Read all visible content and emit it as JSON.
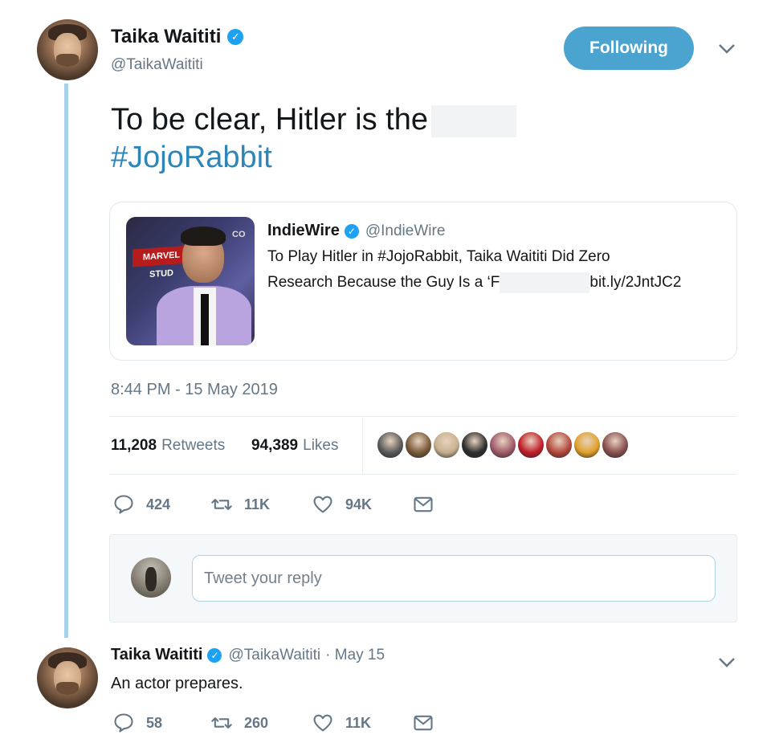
{
  "main_tweet": {
    "author_name": "Taika Waititi",
    "author_handle": "@TaikaWaititi",
    "follow_label": "Following",
    "text_line1": "To be clear, Hitler is the",
    "hashtag": "#JojoRabbit",
    "quote": {
      "author_name": "IndieWire",
      "author_handle": "@IndieWire",
      "text_line1": "To Play Hitler in #JojoRabbit, Taika Waititi Did Zero",
      "text_line2_start": "Research Because the Guy Is a ‘F",
      "text_line2_end": "bit.ly/2JntJC2",
      "image_texts": [
        "MARVEL STUD",
        "CO"
      ]
    },
    "timestamp": "8:44 PM - 15 May 2019",
    "retweets_count": "11,208",
    "retweets_label": "Retweets",
    "likes_count": "94,389",
    "likes_label": "Likes",
    "actions": {
      "reply_count": "424",
      "retweet_count": "11K",
      "like_count": "94K"
    },
    "liker_avatar_colors": [
      "#5a5a5a",
      "#7a5a3a",
      "#c7b08f",
      "#2e2e2e",
      "#a05a6a",
      "#c01f2a",
      "#b5483d",
      "#e0a12a",
      "#8a5050"
    ]
  },
  "reply_box": {
    "placeholder": "Tweet your reply"
  },
  "reply_tweet": {
    "author_name": "Taika Waititi",
    "author_handle": "@TaikaWaititi",
    "date": "· May 15",
    "text": "An actor prepares.",
    "actions": {
      "reply_count": "58",
      "retweet_count": "260",
      "like_count": "11K"
    }
  },
  "colors": {
    "accent": "#1da1f2",
    "hashtag": "#2e86b8",
    "follow_button": "#4ba3cf",
    "thread_line": "#a7d3ea",
    "muted": "#657786"
  },
  "icons": {
    "reply": "speech-bubble-icon",
    "retweet": "retweet-arrows-icon",
    "like": "heart-icon",
    "dm": "envelope-icon",
    "more": "chevron-down-icon",
    "verified": "verified-badge-icon"
  }
}
